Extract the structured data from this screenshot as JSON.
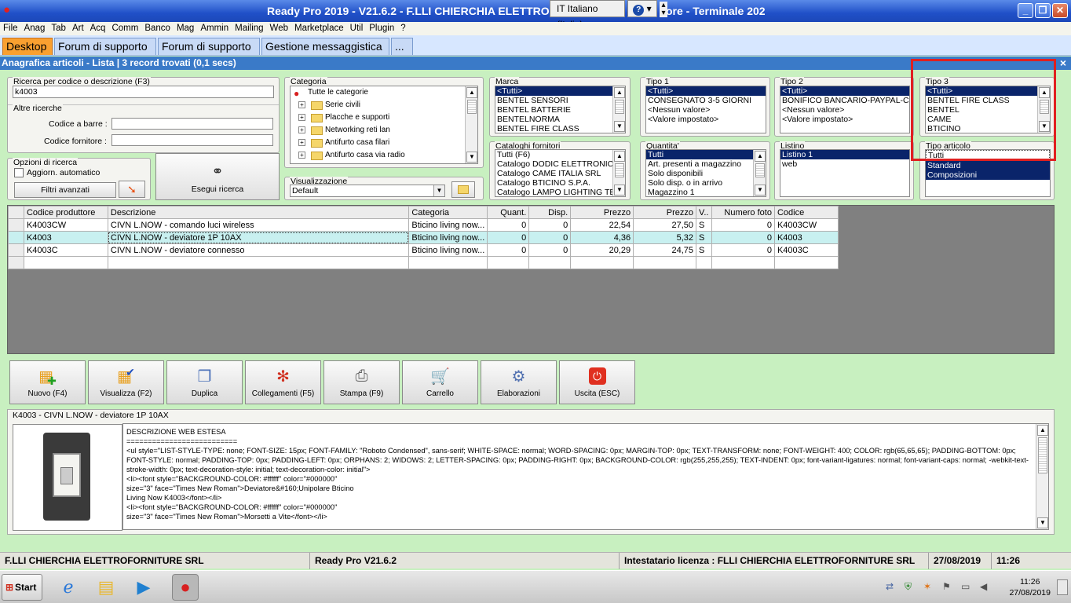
{
  "window": {
    "title": "Ready Pro 2019 - V21.6.2 - F.LLI CHIERCHIA ELETTROFOR",
    "title_suffix": "ore - Terminale 202",
    "language": "IT Italiano (Italia)",
    "help": "?"
  },
  "menu": [
    "File",
    "Anag",
    "Tab",
    "Art",
    "Acq",
    "Comm",
    "Banco",
    "Mag",
    "Ammin",
    "Mailing",
    "Web",
    "Marketplace",
    "Util",
    "Plugin",
    "?"
  ],
  "tabs": [
    "Desktop",
    "Forum di supporto",
    "Forum di supporto",
    "Gestione messaggistica",
    "..."
  ],
  "header": {
    "title": "Anagrafica articoli  - Lista | 3 record trovati (0,1 secs)",
    "close": "×"
  },
  "search": {
    "label": "Ricerca per codice o descrizione (F3)",
    "value": "k4003",
    "other_label": "Altre ricerche",
    "barcode_label": "Codice a barre :",
    "barcode_value": "",
    "supplier_label": "Codice fornitore :",
    "supplier_value": ""
  },
  "options": {
    "label": "Opzioni di ricerca",
    "auto_update": "Aggiorn. automatico",
    "advanced_filters": "Filtri avanzati",
    "execute": "Esegui ricerca"
  },
  "categoria": {
    "label": "Categoria",
    "root": "Tutte le categorie",
    "items": [
      "Serie civili",
      "Placche e supporti",
      "Networking reti lan",
      "Antifurto casa filari",
      "Antifurto casa via radio"
    ]
  },
  "visualizzazione": {
    "label": "Visualizzazione",
    "value": "Default"
  },
  "marca": {
    "label": "Marca",
    "items": [
      "<Tutti>",
      "BENTEL SENSORI",
      "BENTEL BATTERIE",
      "BENTELNORMA",
      "BENTEL FIRE CLASS"
    ]
  },
  "cataloghi": {
    "label": "Cataloghi fornitori",
    "items": [
      "Tutti (F6)",
      "Catalogo DODIC ELETTRONICA",
      "Catalogo CAME ITALIA SRL",
      "Catalogo BTICINO S.P.A.",
      "Catalogo LAMPO LIGHTING TEC"
    ]
  },
  "tipo1": {
    "label": "Tipo 1",
    "items": [
      "<Tutti>",
      "CONSEGNATO 3-5 GIORNI",
      "<Nessun valore>",
      "<Valore impostato>"
    ]
  },
  "quantita": {
    "label": "Quantita'",
    "items": [
      "Tutti",
      "Art. presenti a magazzino",
      "Solo disponibili",
      "Solo disp. o in arrivo",
      "Magazzino 1"
    ]
  },
  "tipo2": {
    "label": "Tipo 2",
    "items": [
      "<Tutti>",
      "BONIFICO BANCARIO-PAYPAL-CA",
      "<Nessun valore>",
      "<Valore impostato>"
    ]
  },
  "listino": {
    "label": "Listino",
    "items": [
      "Listino 1",
      "web"
    ]
  },
  "tipo3": {
    "label": "Tipo 3",
    "items": [
      "<Tutti>",
      "BENTEL FIRE CLASS",
      "BENTEL",
      "CAME",
      "BTICINO"
    ]
  },
  "tipo_articolo": {
    "label": "Tipo articolo",
    "items": [
      "Tutti",
      "Standard",
      "Composizioni"
    ]
  },
  "grid": {
    "columns": [
      "Codice produttore",
      "Descrizione",
      "Categoria",
      "Quant.",
      "Disp.",
      "Prezzo",
      "Prezzo",
      "V..",
      "Numero foto",
      "Codice"
    ],
    "rows": [
      [
        "K4003CW",
        "CIVN L.NOW - comando luci wireless",
        "Bticino living now...",
        "0",
        "0",
        "22,54",
        "27,50",
        "S",
        "0",
        "K4003CW"
      ],
      [
        "K4003",
        "CIVN L.NOW - deviatore 1P 10AX",
        "Bticino living now...",
        "0",
        "0",
        "4,36",
        "5,32",
        "S",
        "0",
        "K4003"
      ],
      [
        "K4003C",
        "CIVN L.NOW - deviatore connesso",
        "Bticino living now...",
        "0",
        "0",
        "20,29",
        "24,75",
        "S",
        "0",
        "K4003C"
      ]
    ]
  },
  "toolbar": [
    "Nuovo (F4)",
    "Visualizza (F2)",
    "Duplica",
    "Collegamenti (F5)",
    "Stampa (F9)",
    "Carrello",
    "Elaborazioni",
    "Uscita (ESC)"
  ],
  "detail": {
    "title": "K4003 - CIVN L.NOW - deviatore 1P 10AX",
    "lines": [
      "DESCRIZIONE WEB ESTESA",
      "==========================",
      "<ul style=\"LIST-STYLE-TYPE: none; FONT-SIZE: 15px; FONT-FAMILY: \"Roboto Condensed\", sans-serif; WHITE-SPACE: normal; WORD-SPACING: 0px; MARGIN-TOP: 0px; TEXT-TRANSFORM: none; FONT-WEIGHT: 400; COLOR: rgb(65,65,65); PADDING-BOTTOM: 0px; FONT-STYLE: normal; PADDING-TOP: 0px; PADDING-LEFT: 0px; ORPHANS: 2; WIDOWS: 2; LETTER-SPACING: 0px; PADDING-RIGHT: 0px; BACKGROUND-COLOR: rgb(255,255,255); TEXT-INDENT: 0px; font-variant-ligatures: normal; font-variant-caps: normal; -webkit-text-stroke-width: 0px; text-decoration-style: initial; text-decoration-color: initial\">",
      "<li><font style=\"BACKGROUND-COLOR: #ffffff\" color=\"#000000\"",
      "size=\"3\" face=\"Times New Roman\">Deviatore&#160;Unipolare Bticino",
      "Living Now K4003</font></li>",
      "<li><font style=\"BACKGROUND-COLOR: #ffffff\" color=\"#000000\"",
      "size=\"3\" face=\"Times New Roman\">Morsetti a Vite</font></li>"
    ]
  },
  "status": {
    "company": "F.LLI CHIERCHIA ELETTROFORNITURE SRL",
    "version": "Ready Pro V21.6.2",
    "license": "Intestatario licenza : FLLI CHIERCHIA ELETTROFORNITURE SRL",
    "date": "27/08/2019",
    "time": "11:26"
  },
  "taskbar": {
    "start": "Start",
    "clock_time": "11:26",
    "clock_date": "27/08/2019"
  }
}
